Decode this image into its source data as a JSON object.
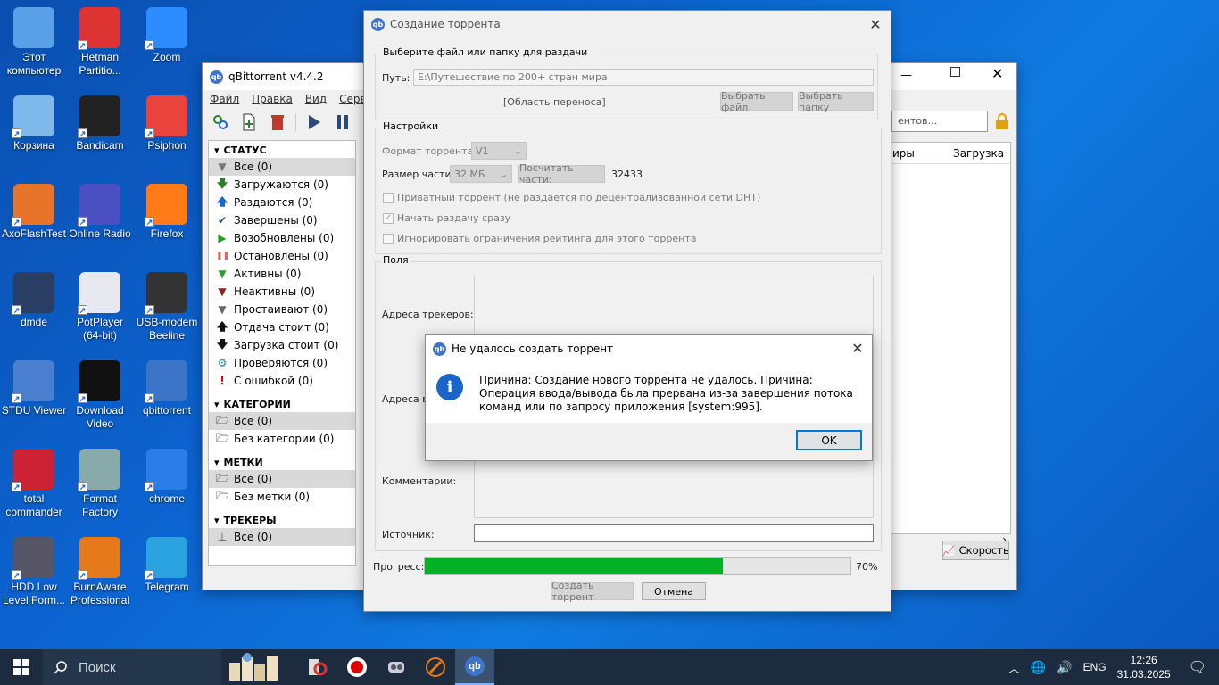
{
  "desktop": {
    "icons": [
      {
        "label": "Этот компьютер",
        "icon": "computer-icon",
        "color": "#5aa0e6"
      },
      {
        "label": "Hetman Partitio...",
        "icon": "lifebuoy-icon",
        "color": "#d33"
      },
      {
        "label": "Zoom",
        "icon": "zoom-icon",
        "color": "#2d8cff"
      },
      {
        "label": "Корзина",
        "icon": "recycle-bin-icon",
        "color": "#7fb8ea"
      },
      {
        "label": "Bandicam",
        "icon": "record-icon",
        "color": "#222"
      },
      {
        "label": "Psiphon",
        "icon": "psiphon-icon",
        "color": "#e8433c"
      },
      {
        "label": "AxoFlashTest",
        "icon": "axo-icon",
        "color": "#e8742a"
      },
      {
        "label": "Online Radio",
        "icon": "radio-icon",
        "color": "#4b4fc2"
      },
      {
        "label": "Firefox",
        "icon": "firefox-icon",
        "color": "#ff7a18"
      },
      {
        "label": "dmde",
        "icon": "dmde-icon",
        "color": "#2a3d63"
      },
      {
        "label": "PotPlayer (64-bit)",
        "icon": "potplayer-icon",
        "color": "#e8e8f0"
      },
      {
        "label": "USB-modem Beeline",
        "icon": "modem-icon",
        "color": "#333"
      },
      {
        "label": "STDU Viewer",
        "icon": "magnifier-icon",
        "color": "#4a7fd0"
      },
      {
        "label": "Download Video",
        "icon": "terminal-icon",
        "color": "#111"
      },
      {
        "label": "qbittorrent",
        "icon": "qbittorrent-icon",
        "color": "#3c74c8"
      },
      {
        "label": "total commander",
        "icon": "floppy-icon",
        "color": "#c23"
      },
      {
        "label": "Format Factory",
        "icon": "format-factory-icon",
        "color": "#8aa"
      },
      {
        "label": "chrome",
        "icon": "chrome-icon",
        "color": "#2b7de9"
      },
      {
        "label": "HDD Low Level Form...",
        "icon": "hdd-icon",
        "color": "#556"
      },
      {
        "label": "BurnAware Professional",
        "icon": "burn-icon",
        "color": "#e67a1a"
      },
      {
        "label": "Telegram",
        "icon": "telegram-icon",
        "color": "#2aa3e0"
      }
    ]
  },
  "main_window": {
    "title": "qBittorrent v4.4.2",
    "menu": [
      "Файл",
      "Правка",
      "Вид",
      "Серви"
    ],
    "search_placeholder": "ентов...",
    "columns": [
      "иры",
      "Загрузка"
    ],
    "speed_button": "Скорость",
    "sidebar": {
      "status_header": "СТАТУС",
      "status_items": [
        {
          "label": "Все (0)",
          "icon": "filter-icon",
          "color": "#777"
        },
        {
          "label": "Загружаются (0)",
          "icon": "arrow-down-icon",
          "color": "#2e7d32"
        },
        {
          "label": "Раздаются (0)",
          "icon": "arrow-up-icon",
          "color": "#1e66c8"
        },
        {
          "label": "Завершены (0)",
          "icon": "checkmark-icon",
          "color": "#2a4a7a"
        },
        {
          "label": "Возобновлены (0)",
          "icon": "play-icon",
          "color": "#2e9b2e"
        },
        {
          "label": "Остановлены (0)",
          "icon": "pause-icon",
          "color": "#e06060"
        },
        {
          "label": "Активны (0)",
          "icon": "filter-icon",
          "color": "#2e9b2e"
        },
        {
          "label": "Неактивны (0)",
          "icon": "filter-icon",
          "color": "#8b2020"
        },
        {
          "label": "Простаивают (0)",
          "icon": "filter-icon",
          "color": "#666"
        },
        {
          "label": "Отдача стоит (0)",
          "icon": "arrow-up-icon",
          "color": "#111"
        },
        {
          "label": "Загрузка стоит (0)",
          "icon": "arrow-down-icon",
          "color": "#111"
        },
        {
          "label": "Проверяются (0)",
          "icon": "gear-icon",
          "color": "#1a8a8a"
        },
        {
          "label": "С ошибкой (0)",
          "icon": "exclamation-icon",
          "color": "#d00"
        }
      ],
      "categories_header": "КАТЕГОРИИ",
      "category_items": [
        "Все (0)",
        "Без категории (0)"
      ],
      "tags_header": "МЕТКИ",
      "tag_items": [
        "Все (0)",
        "Без метки (0)"
      ],
      "trackers_header": "ТРЕКЕРЫ",
      "tracker_items": [
        "Все (0)"
      ]
    }
  },
  "create_dialog": {
    "title": "Создание торрента",
    "source_group": "Выберите файл или папку для раздачи",
    "path_label": "Путь:",
    "path_value": "E:\\Путешествие по 200+ стран мира",
    "drop_area": "[Область переноса]",
    "select_file": "Выбрать файл",
    "select_folder": "Выбрать папку",
    "settings_group": "Настройки",
    "format_label": "Формат торрента:",
    "format_value": "V1",
    "piece_size_label": "Размер части:",
    "piece_size_value": "32 МБ",
    "calc_pieces": "Посчитать части:",
    "pieces_count": "32433",
    "private_label": "Приватный торрент (не раздаётся по децентрализованной сети DHT)",
    "start_seeding_label": "Начать раздачу сразу",
    "ignore_ratio_label": "Игнорировать ограничения рейтинга для этого торрента",
    "fields_group": "Поля",
    "trackers_label": "Адреса трекеров:",
    "web_seeds_label": "Адреса ве",
    "comments_label": "Комментарии:",
    "source_label": "Источник:",
    "progress_label": "Прогресс:",
    "progress_value": 0.7,
    "progress_text": "70%",
    "create_button": "Создать торрент",
    "cancel_button": "Отмена"
  },
  "error_dialog": {
    "title": "Не удалось создать торрент",
    "message": "Причина: Создание нового торрента не удалось. Причина: Операция ввода/вывода была прервана из-за завершения потока команд или по запросу приложения [system:995].",
    "ok_button": "OK"
  },
  "taskbar": {
    "search_placeholder": "Поиск",
    "language": "ENG",
    "time": "12:26",
    "date": "31.03.2025"
  }
}
